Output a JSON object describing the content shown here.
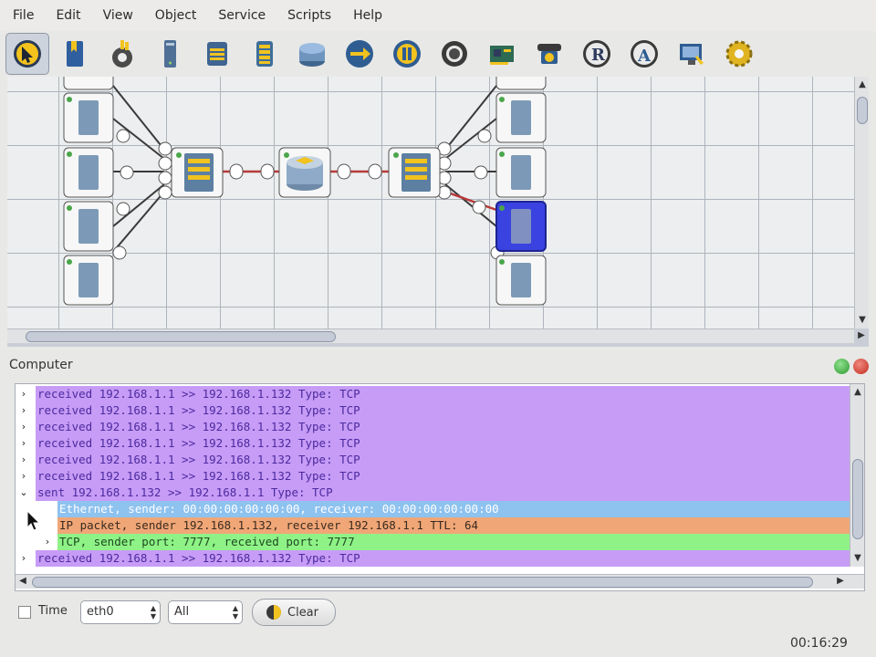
{
  "menu": [
    "File",
    "Edit",
    "View",
    "Object",
    "Service",
    "Scripts",
    "Help"
  ],
  "toolbar": [
    {
      "icon": "pointer-icon",
      "active": true
    },
    {
      "icon": "bookmark-icon"
    },
    {
      "icon": "cable-icon"
    },
    {
      "icon": "computer-tower-icon"
    },
    {
      "icon": "hub-icon"
    },
    {
      "icon": "switch-icon"
    },
    {
      "icon": "router-icon"
    },
    {
      "icon": "connect-arrow-icon"
    },
    {
      "icon": "pause-icon"
    },
    {
      "icon": "ring-icon"
    },
    {
      "icon": "network-card-icon"
    },
    {
      "icon": "phone-icon"
    },
    {
      "icon": "r-letter-icon"
    },
    {
      "icon": "a-letter-icon"
    },
    {
      "icon": "monitor-icon"
    },
    {
      "icon": "gear-icon"
    }
  ],
  "panel": {
    "title": "Computer"
  },
  "log": [
    {
      "expander": "›",
      "text": "received 192.168.1.1 >> 192.168.1.132 Type: TCP",
      "kind": "received"
    },
    {
      "expander": "›",
      "text": "received 192.168.1.1 >> 192.168.1.132 Type: TCP",
      "kind": "received"
    },
    {
      "expander": "›",
      "text": "received 192.168.1.1 >> 192.168.1.132 Type: TCP",
      "kind": "received"
    },
    {
      "expander": "›",
      "text": "received 192.168.1.1 >> 192.168.1.132 Type: TCP",
      "kind": "received"
    },
    {
      "expander": "›",
      "text": "received 192.168.1.1 >> 192.168.1.132 Type: TCP",
      "kind": "received"
    },
    {
      "expander": "›",
      "text": "received 192.168.1.1 >> 192.168.1.132 Type: TCP",
      "kind": "received"
    },
    {
      "expander": "⌄",
      "text": "sent 192.168.1.132 >> 192.168.1.1 Type: TCP",
      "kind": "sent"
    },
    {
      "expander": "",
      "text": "Ethernet, sender: 00:00:00:00:00:00, receiver: 00:00:00:00:00:00",
      "kind": "ethernet"
    },
    {
      "expander": "",
      "text": "IP packet, sender 192.168.1.132, receiver 192.168.1.1 TTL: 64",
      "kind": "ip"
    },
    {
      "expander": "›",
      "text": "TCP, sender port: 7777, received port: 7777",
      "kind": "tcp"
    },
    {
      "expander": "›",
      "text": "received 192.168.1.1 >> 192.168.1.132 Type: TCP",
      "kind": "received"
    }
  ],
  "bottom": {
    "time_label": "Time",
    "interface": "eth0",
    "filter": "All",
    "clear_label": "Clear",
    "clock": "00:16:29"
  },
  "colors": {
    "received": "#c79cf6",
    "ethernet": "#8ec2ef",
    "ip": "#f0a676",
    "tcp": "#8ef287",
    "selected_node": "#3a42e0"
  }
}
